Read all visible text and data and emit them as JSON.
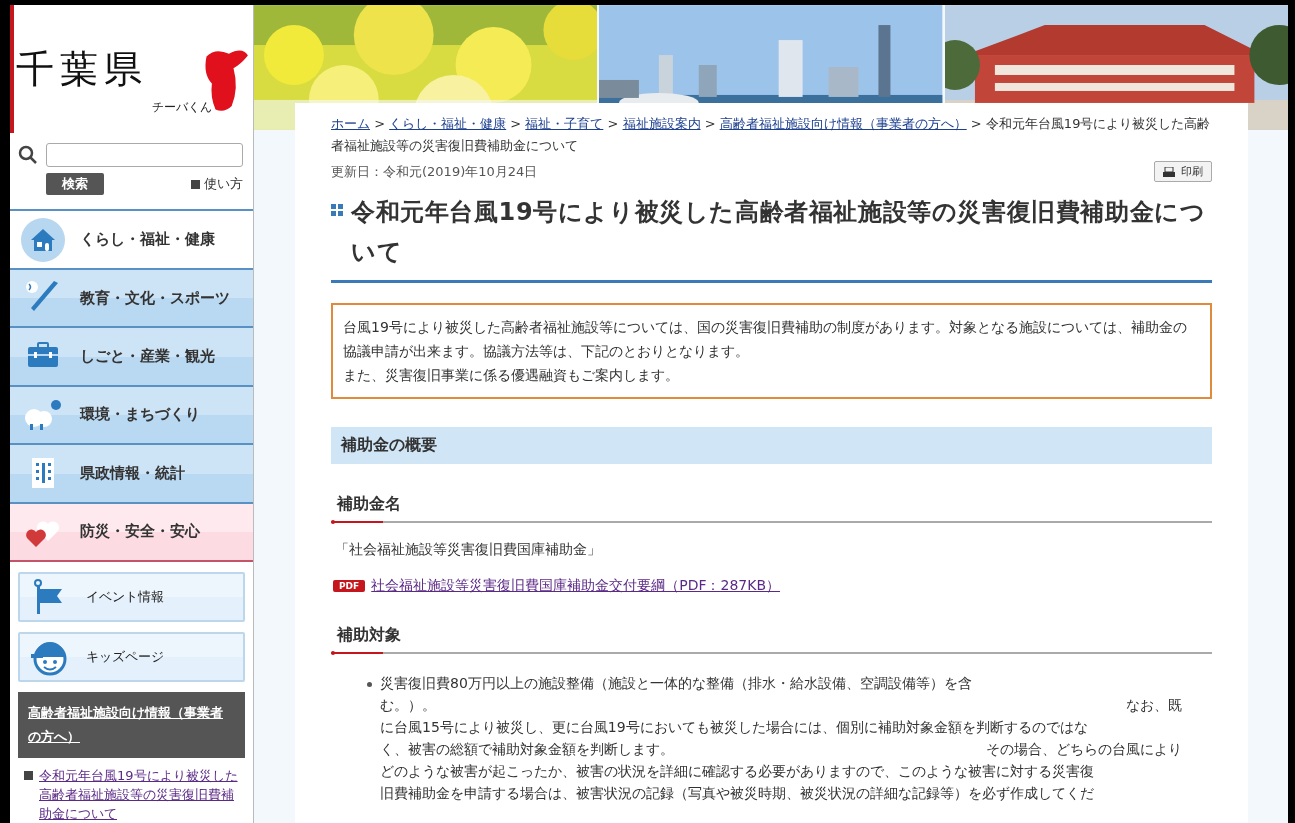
{
  "logo": {
    "title": "千葉県",
    "mascot_caption": "チーバくん"
  },
  "search": {
    "button": "検索",
    "help_link": "使い方"
  },
  "categories": [
    {
      "label": "くらし・福祉・健康",
      "kind": "standard",
      "selected": true
    },
    {
      "label": "教育・文化・スポーツ",
      "kind": "standard",
      "selected": false
    },
    {
      "label": "しごと・産業・観光",
      "kind": "standard",
      "selected": false
    },
    {
      "label": "環境・まちづくり",
      "kind": "standard",
      "selected": false
    },
    {
      "label": "県政情報・統計",
      "kind": "standard",
      "selected": false
    },
    {
      "label": "防災・安全・安心",
      "kind": "safety",
      "selected": false
    }
  ],
  "quick_links": [
    {
      "label": "イベント情報"
    },
    {
      "label": "キッズページ"
    }
  ],
  "related": {
    "title": "高齢者福祉施設向け情報（事業者の方へ）",
    "links": [
      "令和元年台風19号により被災した高齢者福祉施設等の災害復旧費補助金について"
    ]
  },
  "breadcrumb": {
    "separator": ">",
    "links": [
      "ホーム",
      "くらし・福祉・健康",
      "福祉・子育て",
      "福祉施設案内",
      "高齢者福祉施設向け情報（事業者の方へ）"
    ],
    "current": "令和元年台風19号により被災した高齢者福祉施設等の災害復旧費補助金について"
  },
  "updated": "更新日：令和元(2019)年10月24日",
  "print_button": "印刷",
  "title": "令和元年台風19号により被災した高齢者福祉施設等の災害復旧費補助金について",
  "intro": [
    "台風19号により被災した高齢者福祉施設等については、国の災害復旧費補助の制度があります。対象となる施設については、補助金の協議申請が出来ます。協議方法等は、下記のとおりとなります。",
    "また、災害復旧事業に係る優遇融資もご案内します。"
  ],
  "section": {
    "title": "補助金の概要",
    "subsections": [
      {
        "title": "補助金名",
        "blocks": [
          {
            "kind": "text",
            "text": "「社会福祉施設等災害復旧費国庫補助金」"
          },
          {
            "kind": "file",
            "badge": "PDF",
            "text": "社会福祉施設等災害復旧費国庫補助金交付要綱（PDF：287KB）"
          }
        ]
      },
      {
        "title": "補助対象",
        "blocks": [
          {
            "kind": "bullet",
            "lines": [
              [
                "災害復旧費80万円以上の施設整備（施設と一体的な整備（排水・給水設備、空調設備等）を含"
              ],
              [
                "む。）。",
                "なお、既"
              ],
              [
                "に台風15号により被災し、更に台風19号においても被災した場合には、個別に補助対象金額を判断するのではな"
              ],
              [
                "く、被害の総額で補助対象金額を判断します。",
                "その場合、どちらの台風により"
              ],
              [
                "どのような被害が起こったか、被害の状況を詳細に確認する必要がありますので、このような被害に対する災害復"
              ],
              [
                "旧費補助金を申請する場合は、被害状況の記録（写真や被災時期、被災状況の詳細な記録等）を必ず作成してくだ"
              ]
            ]
          }
        ]
      }
    ]
  }
}
